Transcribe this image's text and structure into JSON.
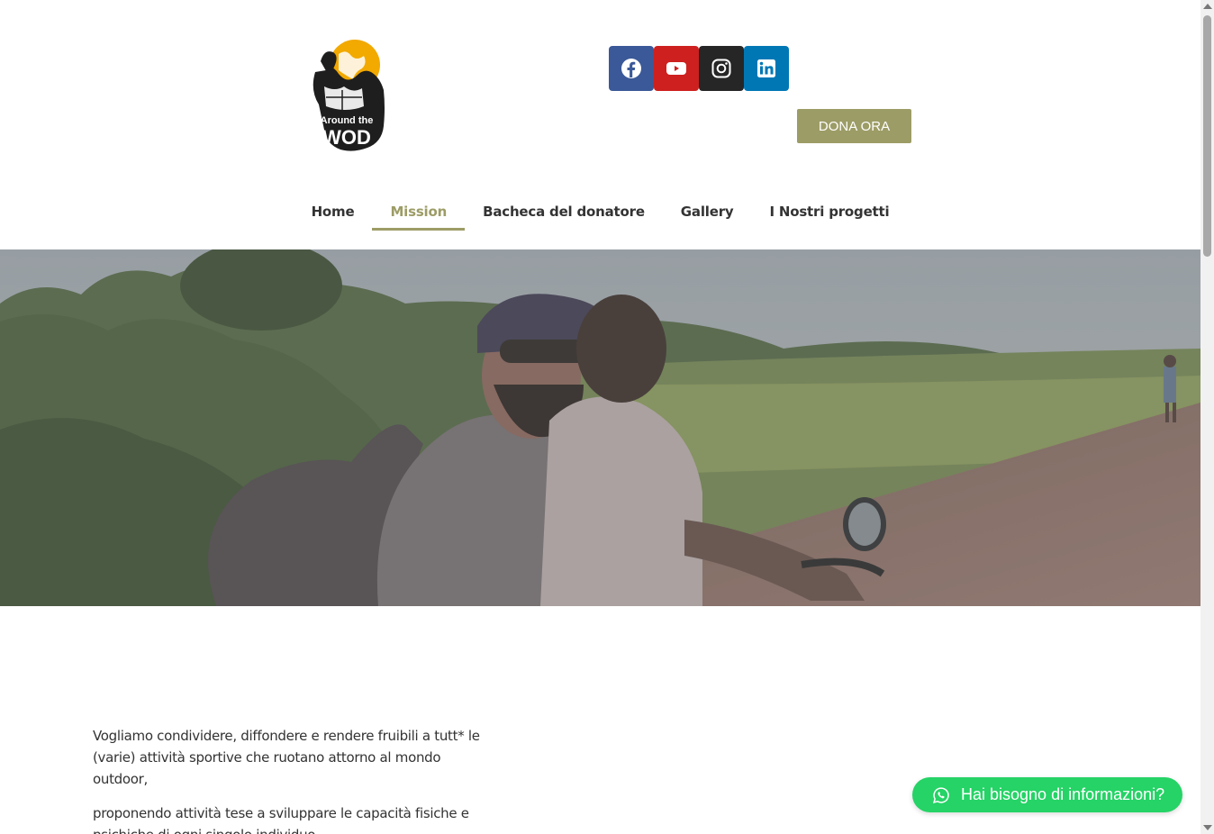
{
  "header": {
    "logo_text": [
      "Around the",
      "WOD"
    ],
    "social": [
      {
        "name": "facebook",
        "icon": "facebook-icon",
        "color": "#3b5998"
      },
      {
        "name": "youtube",
        "icon": "youtube-icon",
        "color": "#cd201f"
      },
      {
        "name": "instagram",
        "icon": "instagram-icon",
        "color": "#262626"
      },
      {
        "name": "linkedin",
        "icon": "linkedin-icon",
        "color": "#0077b5"
      }
    ],
    "donate_label": "DONA ORA",
    "accent_color": "#9c9c66"
  },
  "nav": {
    "items": [
      "Home",
      "Mission",
      "Bacheca del donatore",
      "Gallery",
      "I Nostri progetti"
    ],
    "active": "Mission"
  },
  "content": {
    "paragraph1": "Vogliamo condividere, diffondere e rendere fruibili a tutt* le (varie) attività sportive che ruotano attorno al mondo outdoor,",
    "paragraph2": "proponendo attività tese a sviluppare le capacità fisiche e psichiche di ogni singolo individuo."
  },
  "whatsapp": {
    "label": "Hai bisogno di informazioni?",
    "icon": "whatsapp-icon",
    "color": "#25d366"
  }
}
